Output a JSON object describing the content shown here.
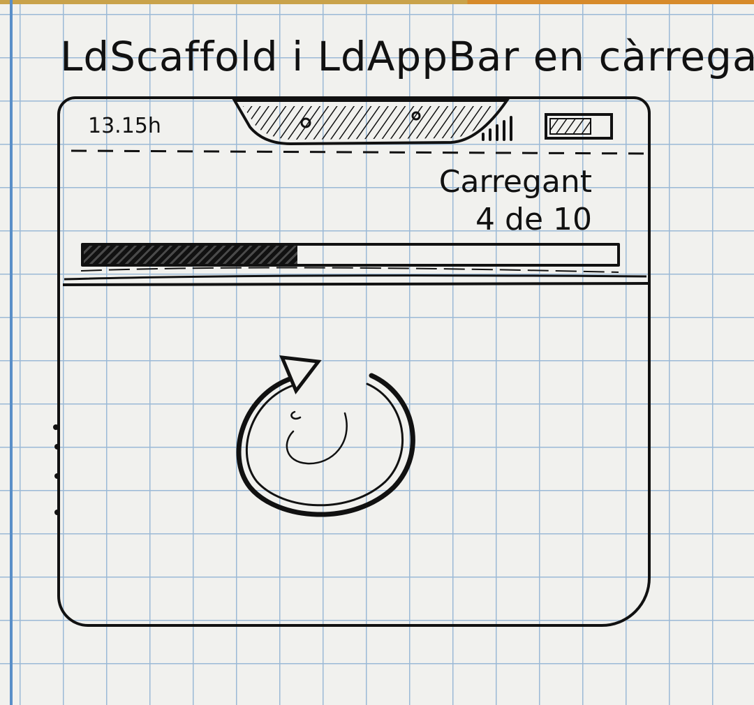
{
  "title": "LdScaffold i LdAppBar en càrrega",
  "status_bar": {
    "time": "13.15h",
    "signal_icon": "signal-bars-icon",
    "battery_icon": "battery-icon"
  },
  "app_bar": {
    "loading_line1": "Carregant",
    "loading_line2": "4 de 10",
    "progress": {
      "current": 4,
      "total": 10
    }
  },
  "body": {
    "spinner_icon": "refresh-spinner-icon"
  },
  "colors": {
    "ink": "#111111",
    "paper": "#f1f1ee",
    "grid": "#9bb9d6",
    "margin": "#5a8fc8"
  }
}
